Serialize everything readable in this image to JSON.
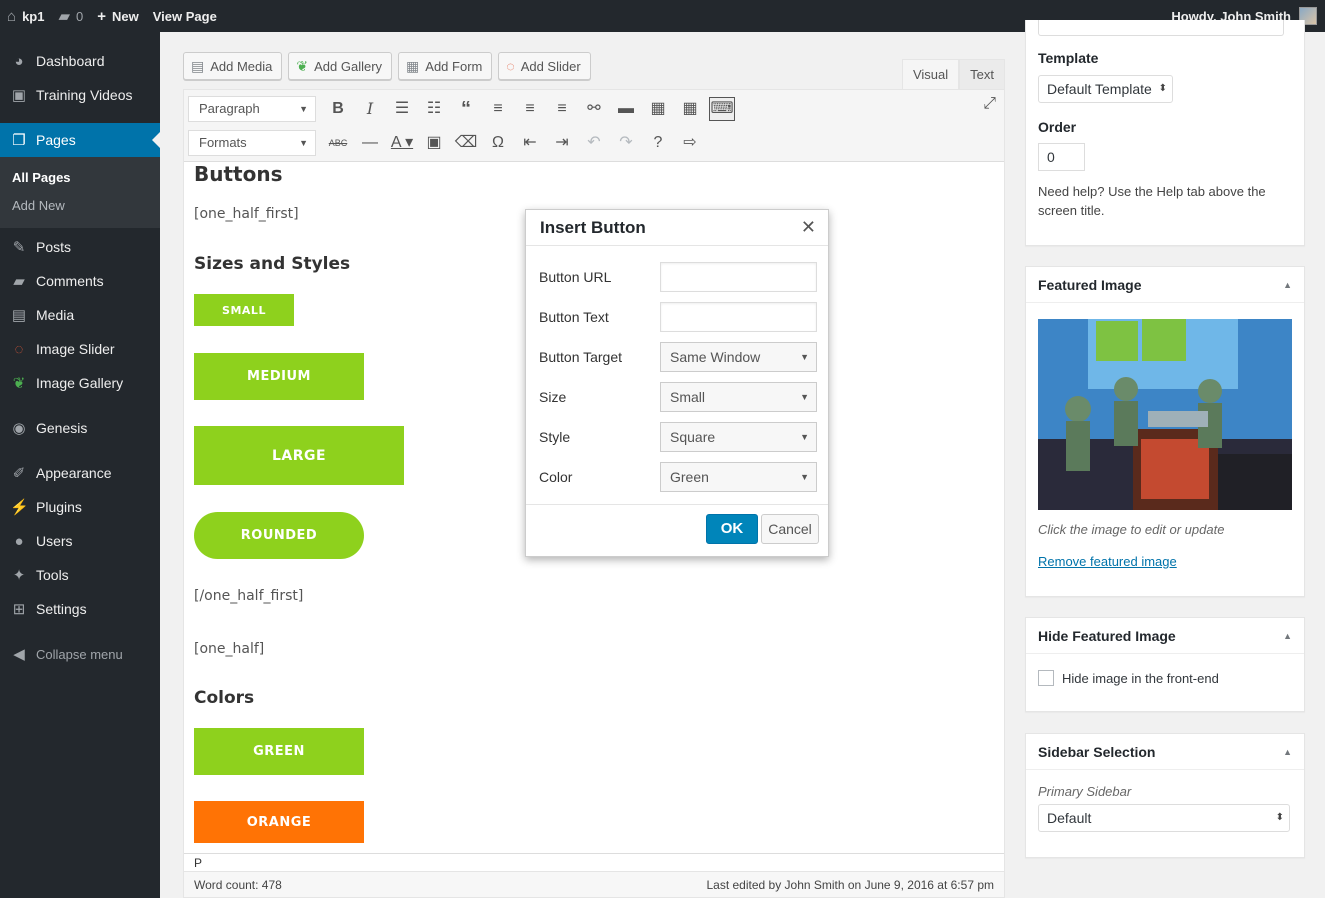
{
  "adminbar": {
    "site": "kp1",
    "comments": "0",
    "new": "New",
    "view": "View Page",
    "howdy": "Howdy, John Smith"
  },
  "sidebar": {
    "items": [
      {
        "label": "Dashboard",
        "icon": "dashboard-icon"
      },
      {
        "label": "Training Videos",
        "icon": "video-icon"
      },
      {
        "label": "Pages",
        "icon": "pages-icon"
      },
      {
        "label": "Posts",
        "icon": "pin-icon"
      },
      {
        "label": "Comments",
        "icon": "comment-icon"
      },
      {
        "label": "Media",
        "icon": "media-icon"
      },
      {
        "label": "Image Slider",
        "icon": "slider-icon"
      },
      {
        "label": "Image Gallery",
        "icon": "leaf-icon"
      },
      {
        "label": "Genesis",
        "icon": "genesis-icon"
      },
      {
        "label": "Appearance",
        "icon": "brush-icon"
      },
      {
        "label": "Plugins",
        "icon": "plugin-icon"
      },
      {
        "label": "Users",
        "icon": "user-icon"
      },
      {
        "label": "Tools",
        "icon": "wrench-icon"
      },
      {
        "label": "Settings",
        "icon": "settings-icon"
      }
    ],
    "submenu": [
      "All Pages",
      "Add New"
    ],
    "collapse": "Collapse menu"
  },
  "media_buttons": [
    "Add Media",
    "Add Gallery",
    "Add Form",
    "Add Slider"
  ],
  "tabs": [
    "Visual",
    "Text"
  ],
  "toolbar": {
    "paragraph": "Paragraph",
    "formats": "Formats"
  },
  "content": {
    "h_buttons": "Buttons",
    "sc1": "[one_half_first]",
    "h_sizes": "Sizes and Styles",
    "btn_small": "SMALL",
    "btn_medium": "MEDIUM",
    "btn_large": "LARGE",
    "btn_rounded": "ROUNDED",
    "sc2": "[/one_half_first]",
    "sc3": "[one_half]",
    "h_colors": "Colors",
    "btn_green": "GREEN",
    "btn_orange": "ORANGE",
    "green": "#8ed11d",
    "orange": "#ff7305"
  },
  "status": {
    "path": "P",
    "wordcount": "Word count: 478",
    "lastedited": "Last edited by John Smith on June 9, 2016 at 6:57 pm"
  },
  "modal": {
    "title": "Insert Button",
    "url_label": "Button URL",
    "text_label": "Button Text",
    "target_label": "Button Target",
    "target_value": "Same Window",
    "size_label": "Size",
    "size_value": "Small",
    "style_label": "Style",
    "style_value": "Square",
    "color_label": "Color",
    "color_value": "Green",
    "ok": "OK",
    "cancel": "Cancel"
  },
  "right": {
    "template_label": "Template",
    "template_value": "Default Template",
    "order_label": "Order",
    "order_value": "0",
    "help": "Need help? Use the Help tab above the screen title.",
    "featured_title": "Featured Image",
    "featured_caption": "Click the image to edit or update",
    "featured_remove": "Remove featured image",
    "hide_title": "Hide Featured Image",
    "hide_label": "Hide image in the front-end",
    "sidebar_title": "Sidebar Selection",
    "primary_label": "Primary Sidebar",
    "primary_value": "Default"
  },
  "colors": {
    "accent": "#0073aa",
    "ok": "#0085ba",
    "adminbar": "#23282d"
  }
}
